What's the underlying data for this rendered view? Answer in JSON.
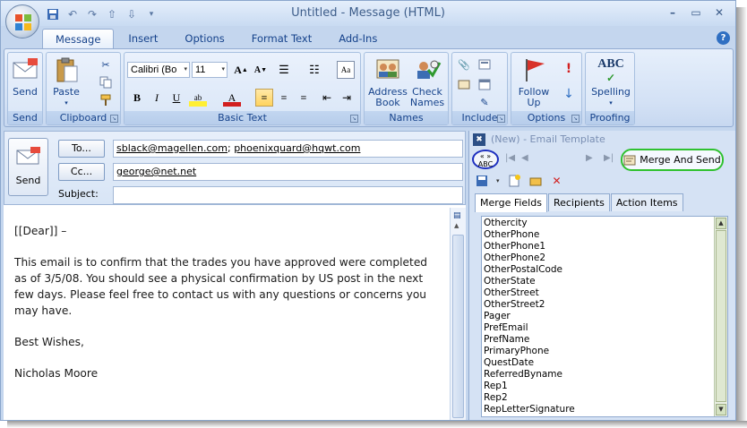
{
  "window": {
    "title": "Untitled - Message (HTML)"
  },
  "ribbon_tabs": [
    "Message",
    "Insert",
    "Options",
    "Format Text",
    "Add-Ins"
  ],
  "groups": {
    "send": {
      "label": "Send",
      "send_label": "Send"
    },
    "clipboard": {
      "label": "Clipboard",
      "paste_label": "Paste"
    },
    "basic_text": {
      "label": "Basic Text",
      "font": "Calibri (Bo",
      "size": "11"
    },
    "names": {
      "label": "Names",
      "address_book": "Address Book",
      "check_names": "Check Names"
    },
    "include": {
      "label": "Include"
    },
    "options": {
      "label": "Options",
      "follow_up": "Follow Up"
    },
    "proofing": {
      "label": "Proofing",
      "spelling": "Spelling",
      "abc": "ABC"
    }
  },
  "compose": {
    "send_label": "Send",
    "to_label": "To...",
    "cc_label": "Cc...",
    "subject_label": "Subject:",
    "to_value_1": "sblack@magellen.com",
    "to_sep": "; ",
    "to_value_2": "phoenixquard@hqwt.com",
    "cc_value": "george@net.net",
    "subject_value": ""
  },
  "body": {
    "greeting": "[[Dear]] –",
    "para1": "This email is to confirm that the trades you have approved were completed as of 3/5/08.  You should see a physical confirmation by US post in the next few days.  Please feel free to contact us with any questions or concerns you may have.",
    "closing": "Best Wishes,",
    "signature": "Nicholas Moore"
  },
  "pane": {
    "title": "(New) - Email Template",
    "toggle_text": "« » ABC",
    "merge_send": "Merge And Send",
    "tabs": [
      "Merge Fields",
      "Recipients",
      "Action Items"
    ],
    "fields": [
      "Othercity",
      "OtherPhone",
      "OtherPhone1",
      "OtherPhone2",
      "OtherPostalCode",
      "OtherState",
      "OtherStreet",
      "OtherStreet2",
      "Pager",
      "PrefEmail",
      "PrefName",
      "PrimaryPhone",
      "QuestDate",
      "ReferredByname",
      "Rep1",
      "Rep2",
      "RepLetterSignature"
    ]
  },
  "colors": {
    "accent": "#15428b",
    "green_highlight": "#2fc12f",
    "blue_highlight": "#1d2fbf"
  }
}
